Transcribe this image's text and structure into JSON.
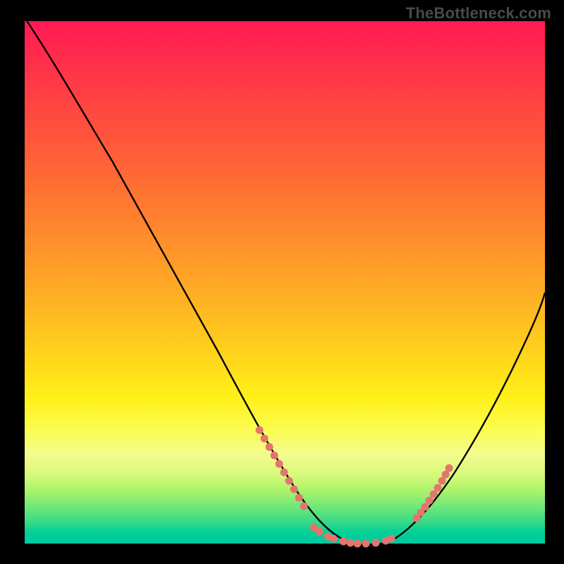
{
  "watermark": "TheBottleneck.com",
  "colors": {
    "frame": "#000000",
    "curve_stroke": "#000000",
    "dot_fill": "#e4756e",
    "grad_top": "#ff1a54",
    "grad_bottom": "#00c9a0"
  },
  "chart_data": {
    "type": "line",
    "title": "",
    "xlabel": "",
    "ylabel": "",
    "xlim": [
      0,
      100
    ],
    "ylim": [
      0,
      100
    ],
    "x": [
      0,
      5,
      10,
      15,
      20,
      25,
      30,
      35,
      40,
      45,
      50,
      55,
      60,
      65,
      70,
      75,
      80,
      85,
      90,
      95,
      100
    ],
    "values": [
      100,
      92,
      83,
      74,
      65,
      56,
      47,
      38,
      29,
      20,
      12,
      6,
      2,
      0,
      0,
      2,
      7,
      14,
      22,
      32,
      44
    ],
    "highlight_points_x": [
      45,
      46,
      47,
      48,
      50,
      53,
      56,
      58,
      60,
      62,
      65,
      67,
      69,
      70,
      74,
      75,
      76,
      77,
      78
    ],
    "highlight_points_y": [
      20,
      18,
      16,
      14,
      12,
      8,
      5,
      3,
      2,
      1,
      0,
      0,
      0,
      0,
      2,
      3,
      5,
      8,
      12
    ]
  }
}
